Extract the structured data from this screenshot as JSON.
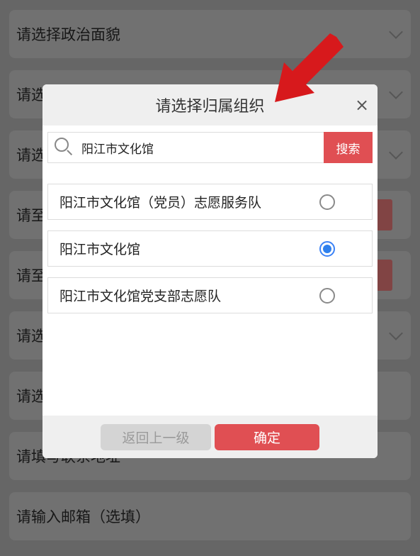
{
  "background_form": {
    "fields": [
      {
        "label": "请选择政治面貌",
        "chevron": true
      },
      {
        "label": "请选",
        "chevron": true
      },
      {
        "label": "请选",
        "chevron": true
      },
      {
        "label": "请至",
        "chevron": false
      },
      {
        "label": "请至",
        "chevron": false
      },
      {
        "label": "请选",
        "chevron": true
      },
      {
        "label": "请选",
        "chevron": false
      },
      {
        "label": "请填写联系地址",
        "chevron": false
      },
      {
        "label": "请输入邮箱（选填）",
        "chevron": false
      }
    ]
  },
  "modal": {
    "title": "请选择归属组织",
    "close_symbol": "×",
    "search": {
      "value": "阳江市文化馆",
      "button_label": "搜索",
      "icon": "search-icon"
    },
    "options": [
      {
        "label": "阳江市文化馆（党员）志愿服务队",
        "selected": false
      },
      {
        "label": "阳江市文化馆",
        "selected": true
      },
      {
        "label": "阳江市文化馆党支部志愿队",
        "selected": false
      }
    ],
    "footer": {
      "back_label": "返回上一级",
      "confirm_label": "确定"
    }
  },
  "annotation": {
    "arrow_icon": "red-arrow-icon",
    "color": "#d7191c"
  },
  "colors": {
    "accent_red": "#e04f53",
    "radio_blue": "#2f80ed"
  }
}
